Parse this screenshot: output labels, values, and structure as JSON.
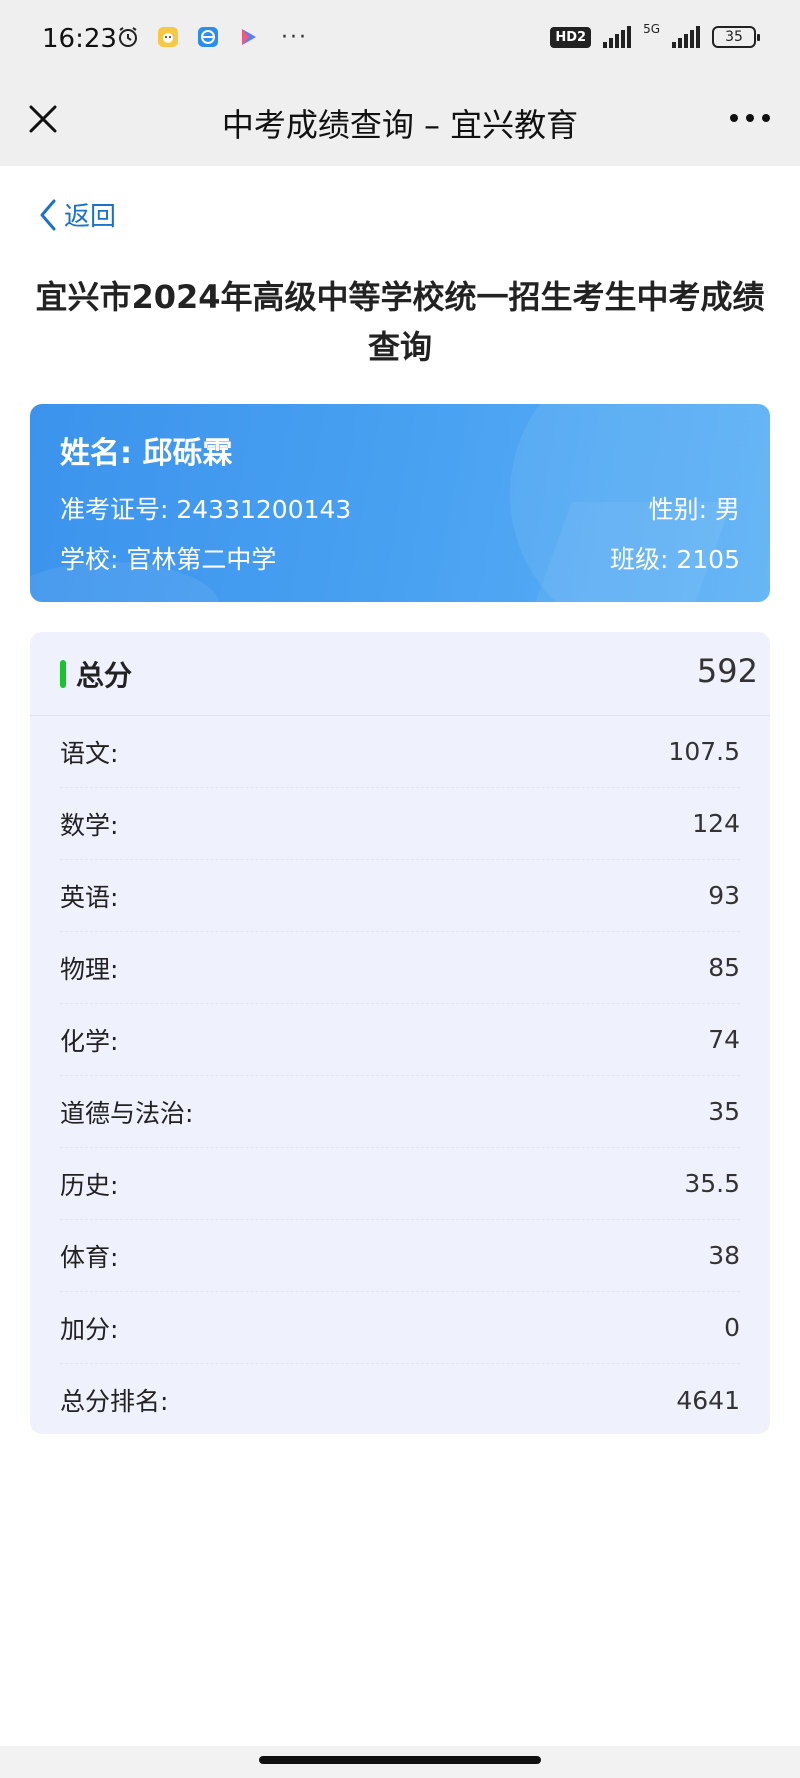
{
  "status_bar": {
    "time": "16:23",
    "hd_badge": "HD2",
    "network": "5G",
    "battery": "35",
    "dots": "···"
  },
  "app_bar": {
    "title": "中考成绩查询 – 宜兴教育"
  },
  "back": {
    "label": "返回"
  },
  "page_title": "宜兴市2024年高级中等学校统一招生考生中考成绩查询",
  "student": {
    "name_line": "姓名: 邱砾霖",
    "exam_id_line": "准考证号: 24331200143",
    "gender_line": "性别: 男",
    "school_line": "学校: 官林第二中学",
    "class_line": "班级: 2105"
  },
  "total": {
    "label": "总分",
    "value": "592"
  },
  "scores": [
    {
      "label": "语文:",
      "value": "107.5"
    },
    {
      "label": "数学:",
      "value": "124"
    },
    {
      "label": "英语:",
      "value": "93"
    },
    {
      "label": "物理:",
      "value": "85"
    },
    {
      "label": "化学:",
      "value": "74"
    },
    {
      "label": "道德与法治:",
      "value": "35"
    },
    {
      "label": "历史:",
      "value": "35.5"
    },
    {
      "label": "体育:",
      "value": "38"
    },
    {
      "label": "加分:",
      "value": "0"
    },
    {
      "label": "总分排名:",
      "value": "4641"
    }
  ],
  "colors": {
    "accent_blue": "#1a73c8",
    "card_blue": "#4aa2f2",
    "score_bg": "#eff1fd",
    "total_bar_green": "#19c32b"
  },
  "icons": [
    "alarm-icon",
    "app-icon-yellow",
    "browser-icon",
    "play-icon",
    "close-icon",
    "more-icon",
    "chevron-left-icon"
  ]
}
